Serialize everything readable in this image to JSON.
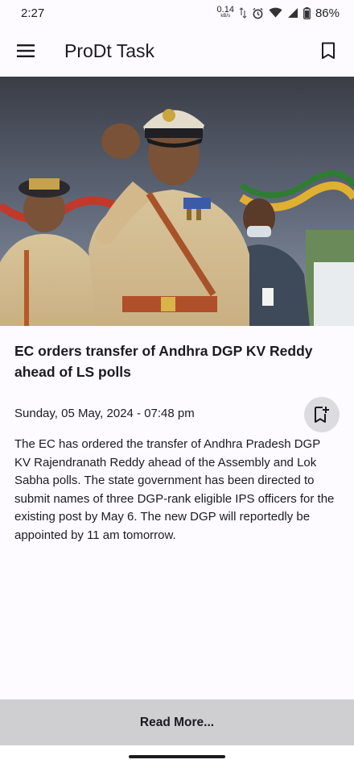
{
  "status_bar": {
    "time": "2:27",
    "net_speed_value": "0.14",
    "net_speed_unit": "kB/s",
    "battery": "86%"
  },
  "app_bar": {
    "title": "ProDt Task",
    "menu_icon": "menu-icon",
    "bookmarks_icon": "bookmark-outline-icon"
  },
  "article": {
    "image_description_icon": "news-photo",
    "headline": "EC orders transfer of Andhra DGP KV Reddy ahead of LS polls",
    "date": "Sunday, 05 May, 2024 - 07:48 pm",
    "bookmark_icon": "bookmark-add-icon",
    "body": "The EC has ordered the transfer of Andhra Pradesh DGP KV Rajendranath Reddy ahead of the Assembly and Lok Sabha polls. The state government has been directed to submit names of three DGP-rank eligible IPS officers for the existing post by May 6. The new DGP will reportedly be appointed by 11 am tomorrow."
  },
  "footer": {
    "read_more_label": "Read More..."
  },
  "colors": {
    "background": "#fdfbff",
    "read_more_bg": "#cfcfd1",
    "fab_bg": "#dcdcde"
  }
}
